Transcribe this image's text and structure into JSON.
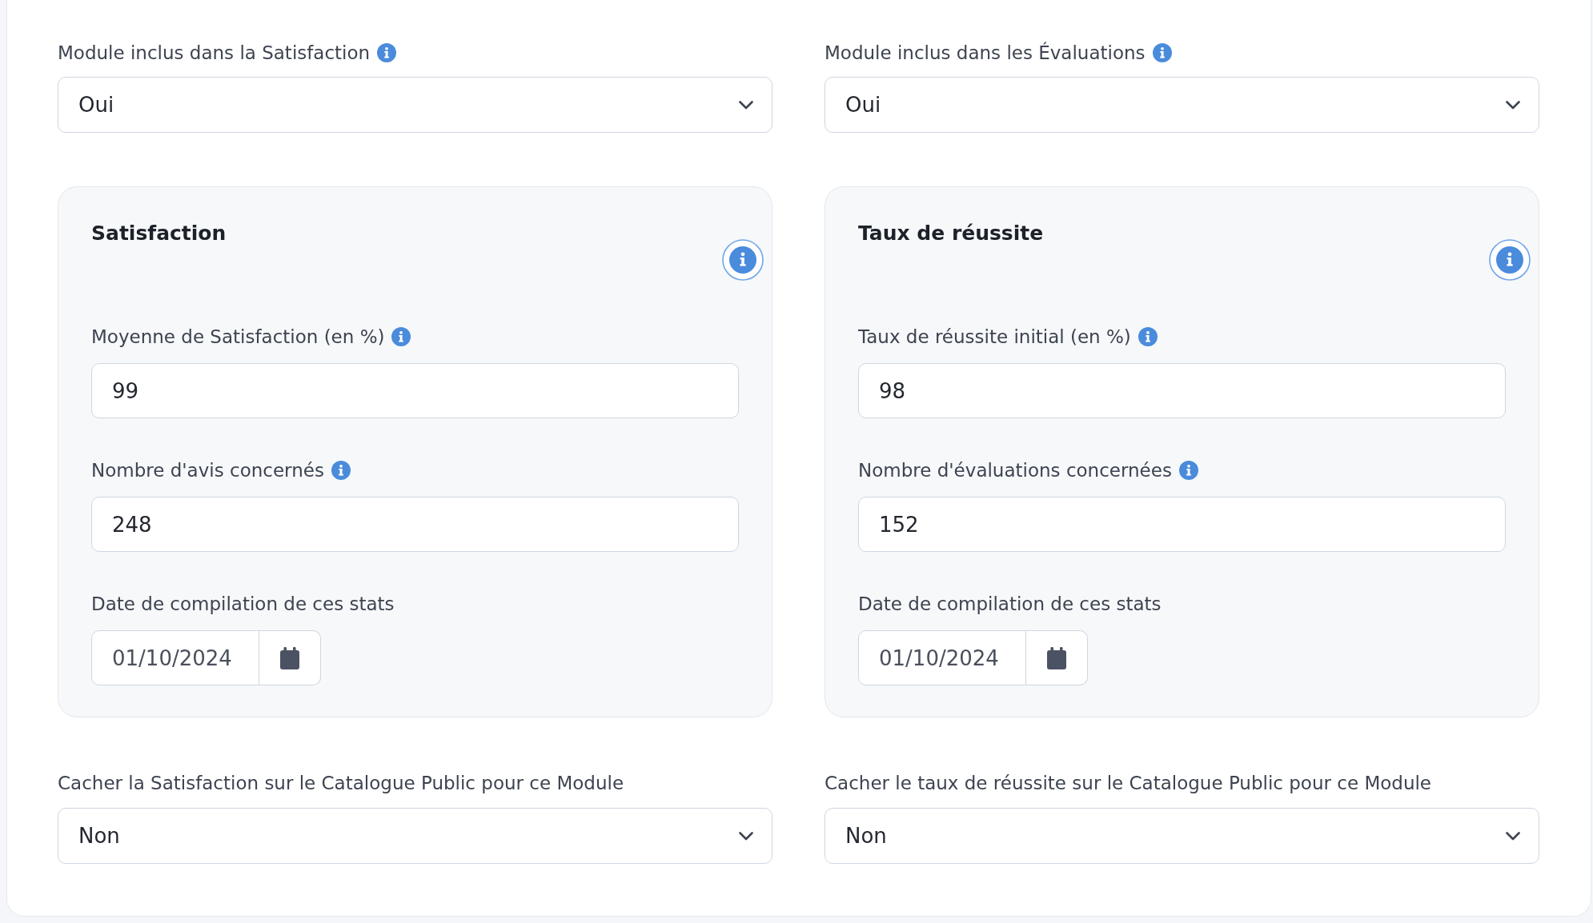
{
  "columns": [
    {
      "include_select": {
        "label": "Module inclus dans la Satisfaction",
        "value": "Oui"
      },
      "card": {
        "title": "Satisfaction",
        "fields": [
          {
            "kind": "number",
            "label": "Moyenne de Satisfaction (en %)",
            "value": "99"
          },
          {
            "kind": "number",
            "label": "Nombre d'avis concernés",
            "value": "248"
          },
          {
            "kind": "date",
            "label": "Date de compilation de ces stats",
            "value": "01/10/2024"
          }
        ]
      },
      "hide_select": {
        "label": "Cacher la Satisfaction sur le Catalogue Public pour ce Module",
        "value": "Non"
      }
    },
    {
      "include_select": {
        "label": "Module inclus dans les Évaluations",
        "value": "Oui"
      },
      "card": {
        "title": "Taux de réussite",
        "fields": [
          {
            "kind": "number",
            "label": "Taux de réussite initial (en %)",
            "value": "98"
          },
          {
            "kind": "number",
            "label": "Nombre d'évaluations concernées",
            "value": "152"
          },
          {
            "kind": "date",
            "label": "Date de compilation de ces stats",
            "value": "01/10/2024"
          }
        ]
      },
      "hide_select": {
        "label": "Cacher le taux de réussite sur le Catalogue Public pour ce Module",
        "value": "Non"
      }
    }
  ]
}
